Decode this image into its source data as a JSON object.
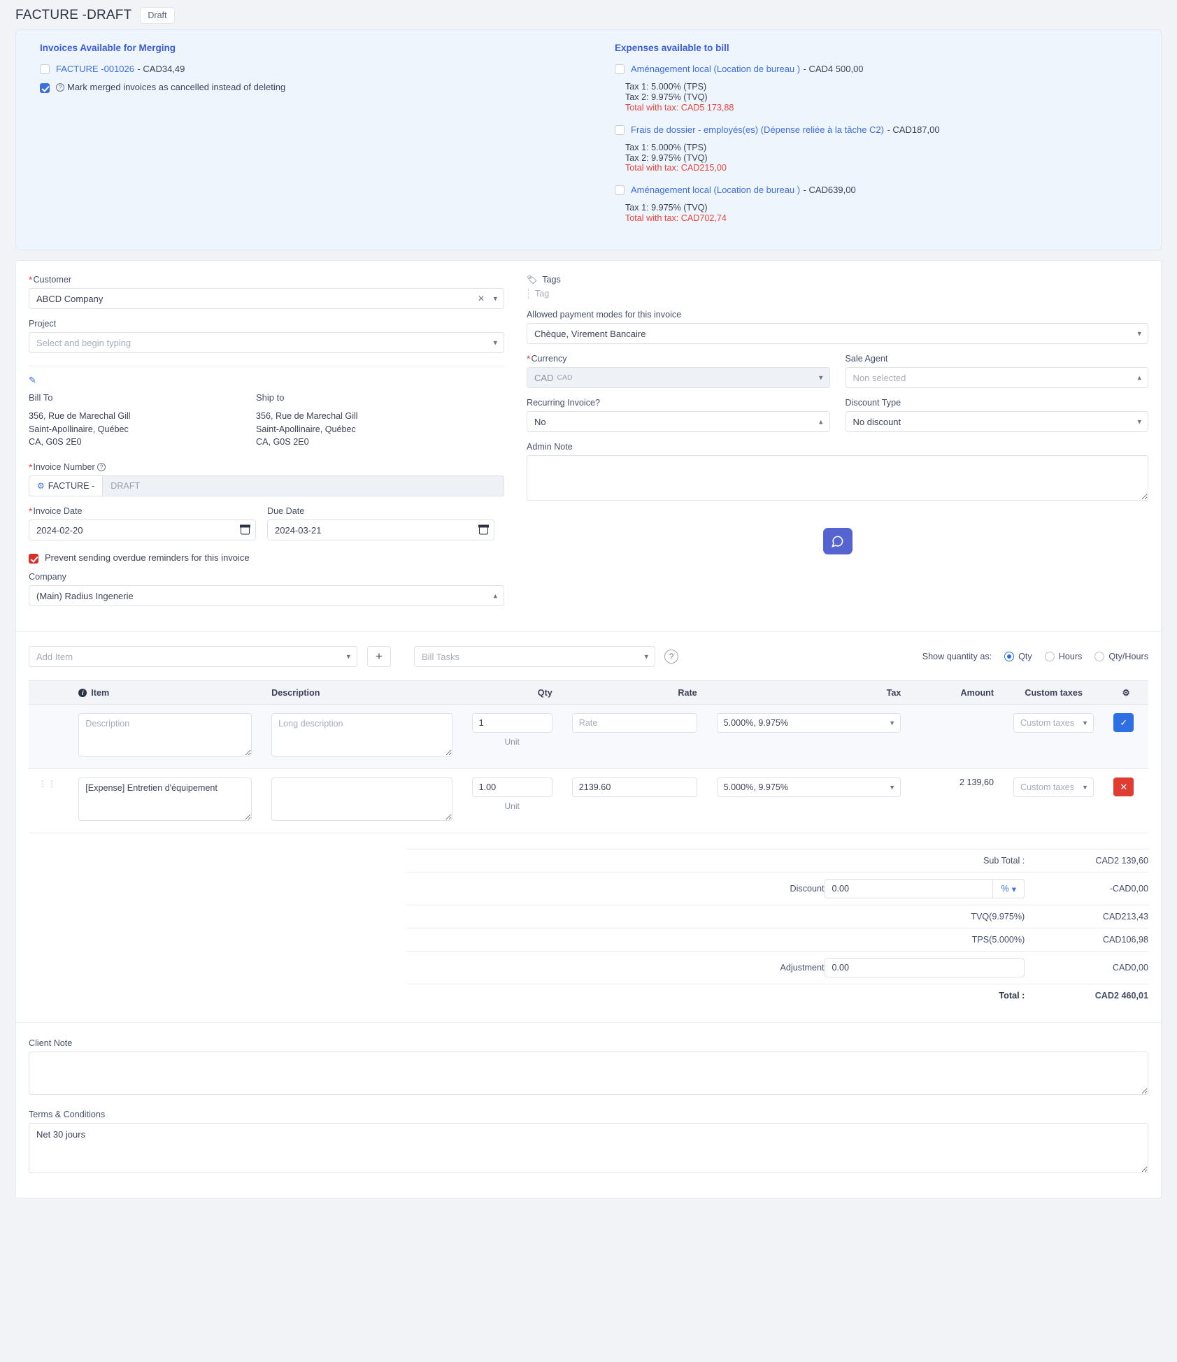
{
  "header": {
    "title": "FACTURE -DRAFT",
    "status_badge": "Draft"
  },
  "merge_panel": {
    "invoices_title": "Invoices Available for Merging",
    "invoice_items": [
      {
        "link": "FACTURE -001026",
        "amount": "- CAD34,49",
        "checked": false
      }
    ],
    "mark_cancelled_label": "Mark merged invoices as cancelled instead of deleting",
    "mark_cancelled_checked": true,
    "expenses_title": "Expenses available to bill",
    "expenses": [
      {
        "name": "Aménagement local (Location de bureau )",
        "amount": "- CAD4 500,00",
        "tax1": "Tax 1: 5.000% (TPS)",
        "tax2": "Tax 2: 9.975% (TVQ)",
        "total": "Total with tax: CAD5 173,88"
      },
      {
        "name": "Frais de dossier - employés(es) (Dépense reliée à la tâche C2)",
        "amount": "- CAD187,00",
        "tax1": "Tax 1: 5.000% (TPS)",
        "tax2": "Tax 2: 9.975% (TVQ)",
        "total": "Total with tax: CAD215,00"
      },
      {
        "name": "Aménagement local (Location de bureau )",
        "amount": "- CAD639,00",
        "tax1": "Tax 1: 9.975% (TVQ)",
        "tax2": "",
        "total": "Total with tax: CAD702,74"
      }
    ]
  },
  "form": {
    "customer_label": "Customer",
    "customer_value": "ABCD Company",
    "project_label": "Project",
    "project_placeholder": "Select and begin typing",
    "bill_to_label": "Bill To",
    "ship_to_label": "Ship to",
    "bill_to_lines": [
      "356, Rue de Marechal Gill",
      "Saint-Apollinaire, Québec",
      "CA, G0S 2E0"
    ],
    "ship_to_lines": [
      "356, Rue de Marechal Gill",
      "Saint-Apollinaire, Québec",
      "CA, G0S 2E0"
    ],
    "invoice_number_label": "Invoice Number",
    "invoice_number_prefix": "FACTURE -",
    "invoice_number_placeholder": "DRAFT",
    "invoice_date_label": "Invoice Date",
    "invoice_date_value": "2024-02-20",
    "due_date_label": "Due Date",
    "due_date_value": "2024-03-21",
    "prevent_reminders_label": "Prevent sending overdue reminders for this invoice",
    "prevent_reminders_checked": true,
    "company_label": "Company",
    "company_value": "(Main) Radius Ingenerie",
    "tags_label": "Tags",
    "tag_placeholder": "Tag",
    "payment_modes_label": "Allowed payment modes for this invoice",
    "payment_modes_value": "Chèque, Virement Bancaire",
    "currency_label": "Currency",
    "currency_value": "CAD",
    "currency_sub": "CAD",
    "sale_agent_label": "Sale Agent",
    "sale_agent_placeholder": "Non selected",
    "recurring_label": "Recurring Invoice?",
    "recurring_value": "No",
    "discount_type_label": "Discount Type",
    "discount_type_value": "No discount",
    "admin_note_label": "Admin Note",
    "admin_note_value": ""
  },
  "items_toolbar": {
    "add_item_placeholder": "Add Item",
    "add_button": "+",
    "bill_tasks_placeholder": "Bill Tasks",
    "help_icon": "?",
    "show_qty_label": "Show quantity as:",
    "qty_options": [
      {
        "label": "Qty",
        "selected": true
      },
      {
        "label": "Hours",
        "selected": false
      },
      {
        "label": "Qty/Hours",
        "selected": false
      }
    ]
  },
  "items_table": {
    "columns": [
      "Item",
      "Description",
      "Qty",
      "Rate",
      "Tax",
      "Amount",
      "Custom taxes",
      "gear-icon"
    ],
    "rows": [
      {
        "type": "blank",
        "item_placeholder": "Description",
        "description_placeholder": "Long description",
        "qty": "1",
        "unit_label": "Unit",
        "rate_placeholder": "Rate",
        "tax": "5.000%, 9.975%",
        "amount": "",
        "custom_taxes_placeholder": "Custom taxes",
        "action": "check"
      },
      {
        "type": "data",
        "item_value": "[Expense] Entretien d'équipement",
        "description_value": "",
        "qty": "1.00",
        "unit_label": "Unit",
        "rate": "2139.60",
        "tax": "5.000%, 9.975%",
        "amount": "2 139,60",
        "custom_taxes_placeholder": "Custom taxes",
        "action": "delete"
      }
    ]
  },
  "totals": {
    "sub_total_label": "Sub Total :",
    "sub_total_value": "CAD2 139,60",
    "discount_label": "Discount",
    "discount_input": "0.00",
    "discount_unit": "%",
    "discount_value": "-CAD0,00",
    "tvq_label": "TVQ(9.975%)",
    "tvq_value": "CAD213,43",
    "tps_label": "TPS(5.000%)",
    "tps_value": "CAD106,98",
    "adjustment_label": "Adjustment",
    "adjustment_input": "0.00",
    "adjustment_value": "CAD0,00",
    "total_label": "Total :",
    "total_value": "CAD2 460,01"
  },
  "notes": {
    "client_note_label": "Client Note",
    "client_note_value": "",
    "terms_label": "Terms & Conditions",
    "terms_value": "Net 30 jours"
  }
}
